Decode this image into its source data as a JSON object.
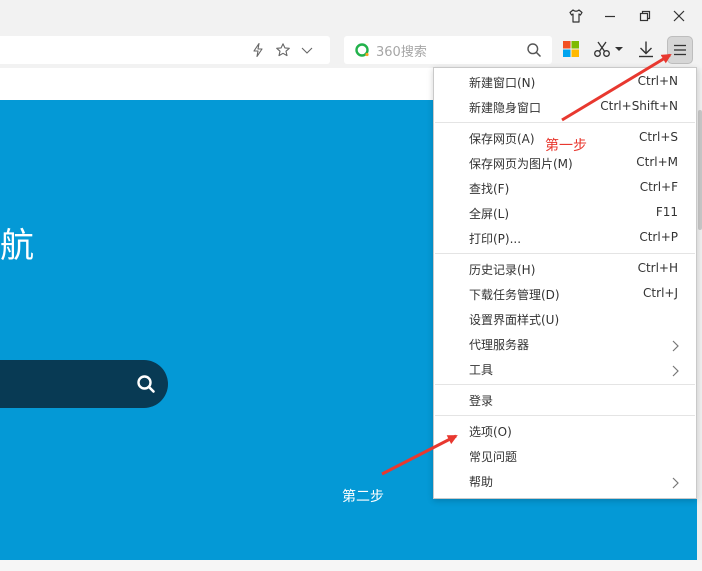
{
  "toolbar": {
    "search_placeholder": "360搜索"
  },
  "hero": {
    "title_fragment": "航"
  },
  "menu": {
    "groups": [
      [
        {
          "label": "新建窗口(N)",
          "shortcut": "Ctrl+N"
        },
        {
          "label": "新建隐身窗口",
          "shortcut": "Ctrl+Shift+N"
        }
      ],
      [
        {
          "label": "保存网页(A)",
          "shortcut": "Ctrl+S"
        },
        {
          "label": "保存网页为图片(M)",
          "shortcut": "Ctrl+M"
        },
        {
          "label": "查找(F)",
          "shortcut": "Ctrl+F"
        },
        {
          "label": "全屏(L)",
          "shortcut": "F11"
        },
        {
          "label": "打印(P)...",
          "shortcut": "Ctrl+P"
        }
      ],
      [
        {
          "label": "历史记录(H)",
          "shortcut": "Ctrl+H"
        },
        {
          "label": "下载任务管理(D)",
          "shortcut": "Ctrl+J"
        },
        {
          "label": "设置界面样式(U)",
          "shortcut": ""
        },
        {
          "label": "代理服务器",
          "shortcut": "",
          "submenu": true
        },
        {
          "label": "工具",
          "shortcut": "",
          "submenu": true
        }
      ],
      [
        {
          "label": "登录",
          "shortcut": ""
        }
      ],
      [
        {
          "label": "选项(O)",
          "shortcut": ""
        },
        {
          "label": "常见问题",
          "shortcut": ""
        },
        {
          "label": "帮助",
          "shortcut": "",
          "submenu": true
        }
      ]
    ]
  },
  "annotations": {
    "step1": {
      "text": "第一步",
      "color": "#e8382f"
    },
    "step2": {
      "text": "第二步",
      "color": "#ffffff"
    }
  },
  "colors": {
    "hero_bg": "#0499d6",
    "arrow": "#e8382f"
  }
}
